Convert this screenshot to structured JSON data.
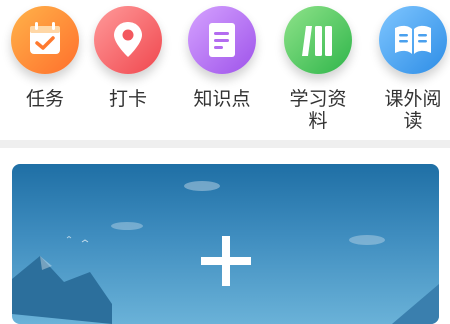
{
  "menu": {
    "items": [
      {
        "label": "任务",
        "icon": "calendar-check-icon",
        "color_from": "#ffb34a",
        "color_to": "#ff6f2c"
      },
      {
        "label": "打卡",
        "icon": "location-pin-icon",
        "color_from": "#ff9a9a",
        "color_to": "#f0474e"
      },
      {
        "label": "知识点",
        "icon": "notebook-icon",
        "color_from": "#d5a2ff",
        "color_to": "#9e53ea"
      },
      {
        "label": "学习资料",
        "label_line2": "料",
        "label_line1": "学习资",
        "icon": "books-icon",
        "color_from": "#8fe38a",
        "color_to": "#2fb54a"
      },
      {
        "label": "课外阅读",
        "label_line1": "课外阅",
        "label_line2": "读",
        "icon": "open-book-icon",
        "color_from": "#7fc6ff",
        "color_to": "#2d8de6"
      }
    ]
  },
  "banner": {
    "action_icon": "plus-icon"
  }
}
